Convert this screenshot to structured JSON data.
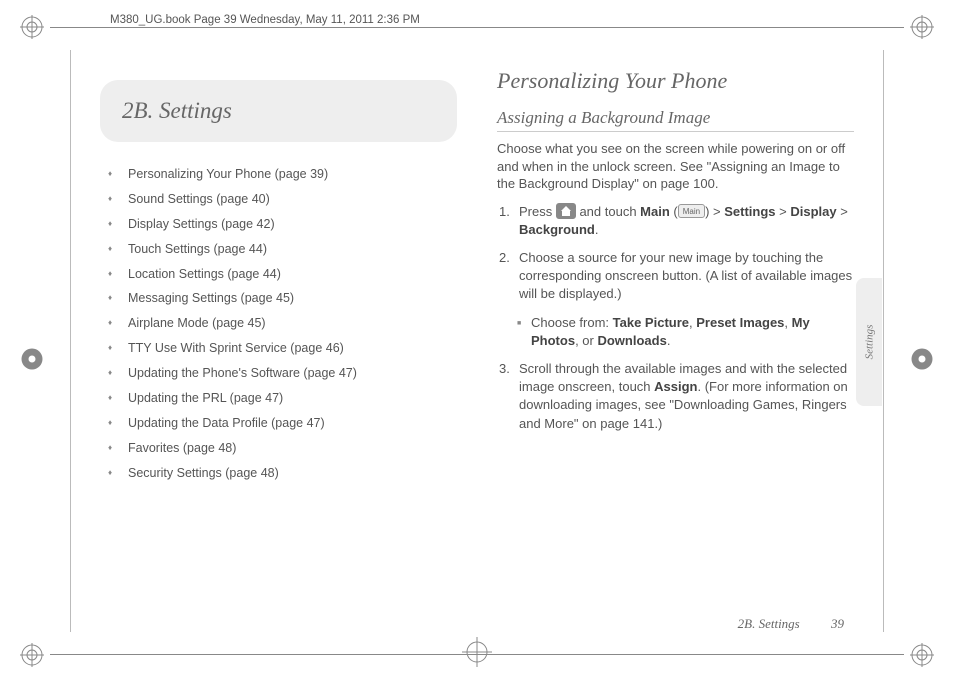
{
  "meta": {
    "header_label": "M380_UG.book  Page 39  Wednesday, May 11, 2011  2:36 PM"
  },
  "chapter": {
    "label": "2B. Settings"
  },
  "toc": [
    "Personalizing Your Phone (page 39)",
    "Sound Settings (page 40)",
    "Display Settings (page 42)",
    "Touch Settings (page 44)",
    "Location Settings (page 44)",
    "Messaging Settings (page 45)",
    "Airplane Mode (page 45)",
    "TTY Use With Sprint Service (page 46)",
    "Updating the Phone's Software (page 47)",
    "Updating the PRL (page 47)",
    "Updating the Data Profile (page 47)",
    "Favorites (page 48)",
    "Security Settings (page 48)"
  ],
  "content": {
    "h1": "Personalizing Your Phone",
    "h2": "Assigning a Background Image",
    "intro": "Choose what you see on the screen while powering on or off and when in the unlock screen. See \"Assigning an Image to the Background Display\" on page 100.",
    "step1_pre": "Press ",
    "step1_mid1": " and touch ",
    "step1_main": "Main",
    "step1_paren_open": " (",
    "step1_main_icon_label": "Main",
    "step1_paren_close": ") > ",
    "step1_settings": "Settings",
    "step1_gt1": " > ",
    "step1_display": "Display",
    "step1_gt2": " > ",
    "step1_background": "Background",
    "step1_period": ".",
    "step2": "Choose a source for your new image by touching the corresponding onscreen button. (A list of available images will be displayed.)",
    "bullet_pre": "Choose from: ",
    "bullet_o1": "Take Picture",
    "bullet_sep1": ", ",
    "bullet_o2": "Preset Images",
    "bullet_sep2": ", ",
    "bullet_o3": "My Photos",
    "bullet_sep3": ", or ",
    "bullet_o4": "Downloads",
    "bullet_period": ".",
    "step3_pre": "Scroll through the available images and with the selected image onscreen, touch ",
    "step3_assign": "Assign",
    "step3_post": ". (For more information on downloading images, see \"Downloading Games, Ringers and More\" on page 141.)"
  },
  "side_tab": "Settings",
  "footer": {
    "section": "2B. Settings",
    "page": "39"
  },
  "step_numbers": {
    "s1": "1.",
    "s2": "2.",
    "s3": "3."
  }
}
